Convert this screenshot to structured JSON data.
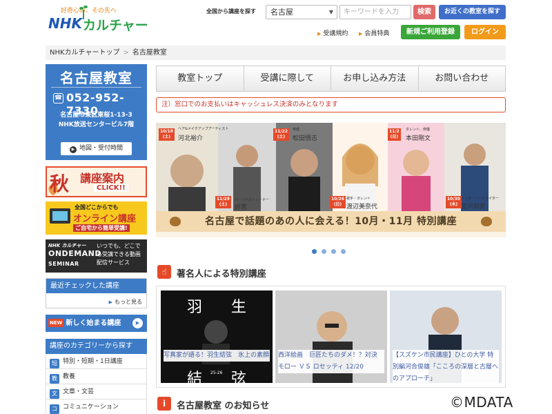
{
  "header": {
    "logo_tagline": "好奇心の、その先へ",
    "logo_brand": "NHK",
    "logo_brand_suffix": "カルチャー",
    "search_label": "全国から講座を探す",
    "area_selected": "名古屋",
    "keyword_placeholder": "キーワードを入力",
    "search_button": "検索",
    "nearby_button": "お近くの教室を探す",
    "terms_link": "受講規約",
    "benefits_link": "会員特典",
    "register_button": "新規ご利用登録",
    "login_button": "ログイン"
  },
  "breadcrumb": {
    "home": "NHKカルチャートップ",
    "current": "名古屋教室"
  },
  "sidebar": {
    "school_name": "名古屋教室",
    "phone": "052-952-7330",
    "address_line1": "名古屋市東区東桜1-13-3",
    "address_line2": "NHK放送センタービル7階",
    "map_button": "地図・受付時間",
    "autumn_banner": {
      "big": "秋",
      "title": "講座案内",
      "click": "CLICK!!"
    },
    "online_banner": {
      "line1": "全国どこからでも",
      "line2": "オンライン講座",
      "line3": "ご自宅から簡単受講!"
    },
    "ondemand_banner": {
      "brand": "NHK カルチャー",
      "line1": "ONDEMAND",
      "line2": "SEMINAR",
      "side": "いつでも、どこでも受講できる動画配信サービス"
    },
    "recent_title": "最近チェックした講座",
    "recent_more": "もっと見る",
    "new_badge": "NEW",
    "new_courses": "新しく始まる講座",
    "category_title": "講座のカテゴリーから探す",
    "categories": [
      {
        "icon": "短",
        "label": "特別・短期・1日講座"
      },
      {
        "icon": "教",
        "label": "教養"
      },
      {
        "icon": "文",
        "label": "文章・文芸"
      },
      {
        "icon": "コ",
        "label": "コミュニケーション"
      }
    ]
  },
  "nav_tabs": [
    "教室トップ",
    "受講に際して",
    "お申し込み方法",
    "お問い合わせ"
  ],
  "notice": "注）窓口でのお支払いはキャッシュレス決済のみとなります",
  "hero": {
    "caption": "名古屋で話題のあの人に会える！10月・11月 特別講座",
    "speakers": [
      {
        "date": "10/18",
        "day": "(土)",
        "role": "ヘア&メイクアップアーティスト",
        "name": "河北裕介"
      },
      {
        "date": "11/29",
        "day": "(土)",
        "role": "パーソナルトレーナー",
        "name": "許恵"
      },
      {
        "date": "11/22",
        "day": "(土)",
        "role": "俳優",
        "name": "松田悟志"
      },
      {
        "date": "10/26",
        "day": "(日)",
        "role": "歌手・タレント",
        "name": "渡辺美奈代"
      },
      {
        "date": "11/2",
        "day": "(日)",
        "role": "タレント、俳優",
        "name": "本田剛文"
      },
      {
        "date": "10/30",
        "day": "(木)",
        "role": "シンガーソングライター",
        "name": "宮沢和史"
      }
    ],
    "slide_count": 4,
    "active_slide": 1
  },
  "special_section": {
    "title": "著名人による特別講座",
    "cards": [
      {
        "caption": "写真家が語る！羽生結弦　氷上の素顔",
        "photo_text": [
          "羽",
          "生",
          "結",
          "弦"
        ],
        "photo_subtext": "25-26"
      },
      {
        "caption": "西洋絵画　巨匠たちのダメ！？対決 モロー ＶＳ ロセッティ 12/20"
      },
      {
        "caption": "【スズケン市民講座】ひとの大学 特別編河合俊雄「こころの深層と古層へのアプローチ」"
      }
    ]
  },
  "news_section": {
    "title": "名古屋教室 のお知らせ"
  },
  "watermark": "©MDATA",
  "colors": {
    "brand_blue": "#3d7bc6",
    "accent_red": "#e44a2a",
    "register_green": "#3aa63a",
    "login_orange": "#f29a1a"
  }
}
